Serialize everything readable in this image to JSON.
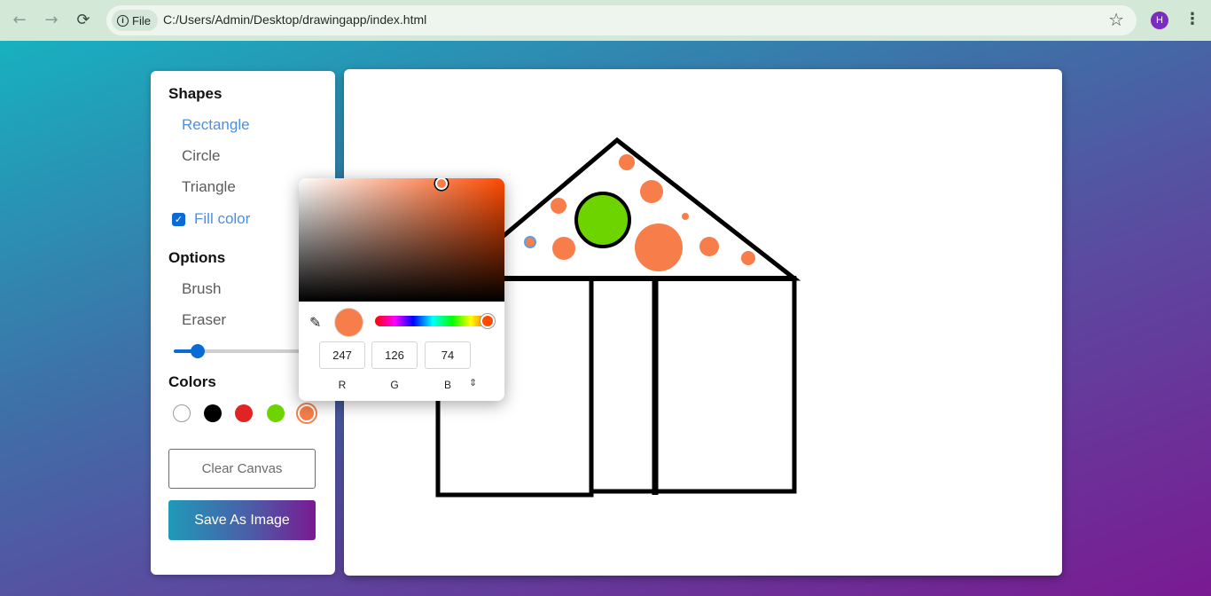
{
  "browser": {
    "back_icon": "arrow-left-icon",
    "forward_icon": "arrow-right-icon",
    "reload_icon": "reload-icon",
    "chip_label": "File",
    "url": "C:/Users/Admin/Desktop/drawingapp/index.html",
    "profile_initial": "H"
  },
  "toolbar": {
    "shapes_title": "Shapes",
    "shapes": [
      "Rectangle",
      "Circle",
      "Triangle"
    ],
    "active_shape": "Rectangle",
    "fill_color_label": "Fill color",
    "fill_color_checked": true,
    "options_title": "Options",
    "options": [
      "Brush",
      "Eraser"
    ],
    "brush_size_fraction": 0.17,
    "colors_title": "Colors",
    "colors": [
      "#ffffff",
      "#000000",
      "#e02424",
      "#6dd400",
      "#f77e4a"
    ],
    "selected_color": "#f77e4a",
    "clear_label": "Clear Canvas",
    "save_label": "Save As Image"
  },
  "color_picker": {
    "r": "247",
    "g": "126",
    "b": "74",
    "r_label": "R",
    "g_label": "G",
    "b_label": "B",
    "current_color": "#f77e4a"
  }
}
